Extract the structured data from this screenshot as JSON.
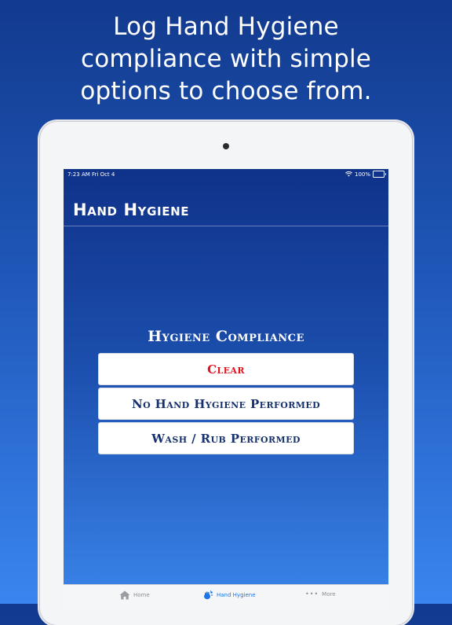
{
  "headline": {
    "line1": "Log Hand Hygiene",
    "line2": "compliance with simple",
    "line3": "options to choose from."
  },
  "status_bar": {
    "time": "7:23 AM   Fri Oct 4",
    "battery": "100%",
    "battery_level": 1.0
  },
  "app": {
    "title": "Hand Hygiene"
  },
  "compliance": {
    "section_title": "Hygiene Compliance",
    "options": [
      {
        "label": "Clear",
        "color": "#e3111c"
      },
      {
        "label": "No Hand Hygiene Performed",
        "color": "#17316f"
      },
      {
        "label": "Wash / Rub Performed",
        "color": "#17316f"
      }
    ]
  },
  "tab_bar": {
    "items": [
      {
        "label": "Home",
        "icon": "home-icon",
        "active": false
      },
      {
        "label": "Hand Hygiene",
        "icon": "hands-icon",
        "active": true
      },
      {
        "label": "More",
        "icon": "more-dots-icon",
        "active": false
      }
    ],
    "active_color": "#1e74e8"
  },
  "colors": {
    "background_top": "#123a8e",
    "background_bottom": "#3a85f0"
  }
}
